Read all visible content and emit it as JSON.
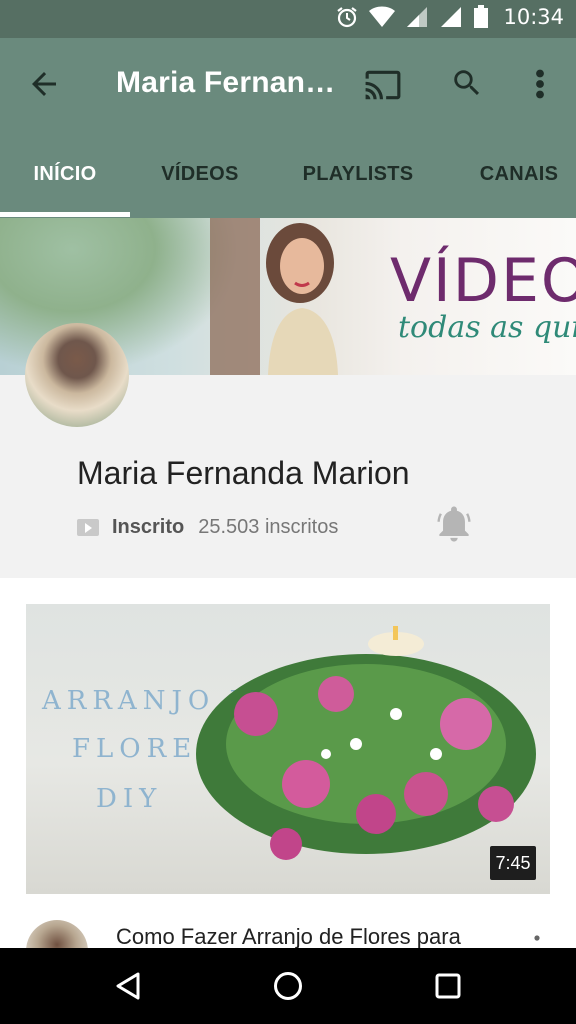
{
  "status_bar": {
    "time": "10:34",
    "icons": [
      "alarm-icon",
      "wifi-icon",
      "signal-icon",
      "battery-icon"
    ]
  },
  "app_bar": {
    "title": "Maria Fernanda Marion",
    "icons": [
      "back-arrow-icon",
      "cast-icon",
      "search-icon",
      "more-vert-icon"
    ]
  },
  "tabs": [
    {
      "label": "INÍCIO",
      "active": true
    },
    {
      "label": "VÍDEOS",
      "active": false
    },
    {
      "label": "PLAYLISTS",
      "active": false
    },
    {
      "label": "CANAIS",
      "active": false
    }
  ],
  "banner": {
    "text_line1": "VÍDEO",
    "text_line2": "todas as quin"
  },
  "channel": {
    "name": "Maria Fernanda Marion",
    "subscribed_label": "Inscrito",
    "subscriber_count": "25.503 inscritos"
  },
  "featured_video": {
    "thumbnail_text": [
      "ARRANJO DE",
      "FLORES",
      "DIY"
    ],
    "duration": "7:45",
    "title": "Como Fazer Arranjo de Flores para"
  },
  "nav_bar": {
    "icons": [
      "back-triangle-icon",
      "home-circle-icon",
      "recents-square-icon"
    ]
  },
  "colors": {
    "app_bar": "#6a8a7d",
    "status_bar": "#566f63",
    "banner_purple": "#6e2b6d",
    "banner_green": "#2f8a78"
  }
}
